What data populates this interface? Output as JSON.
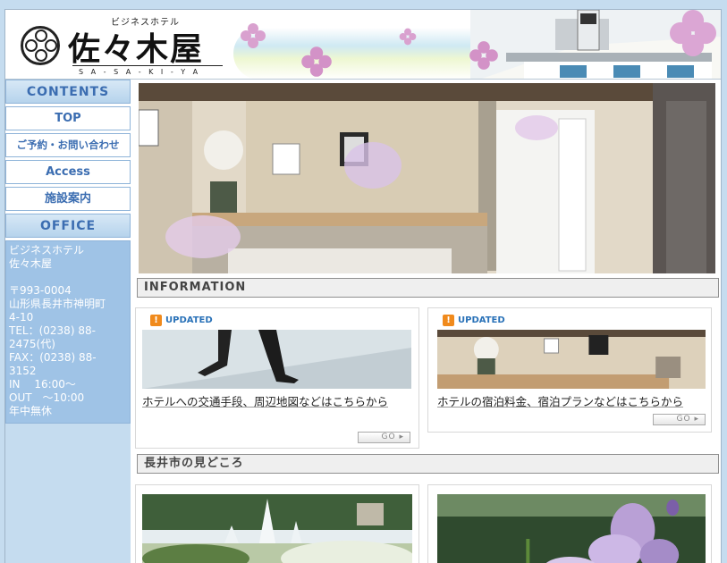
{
  "header": {
    "subtitle": "ビジネスホテル",
    "title": "佐々木屋",
    "roman": "S A - S A - K I - Y A"
  },
  "sidebar": {
    "contents_heading": "CONTENTS",
    "items": [
      {
        "label": "TOP"
      },
      {
        "label": "ご予約・お問い合わせ"
      },
      {
        "label": "Access"
      },
      {
        "label": "施設案内"
      }
    ],
    "office_heading": "OFFICE",
    "office_lines": [
      "ビジネスホテル",
      "佐々木屋",
      "",
      "〒993-0004",
      "山形県長井市神明町",
      "4-10",
      "TEL：(0238) 88-",
      "2475(代)",
      "FAX：(0238) 88-",
      "3152",
      "IN　 16:00～",
      "OUT　～10:00",
      "年中無休"
    ]
  },
  "main": {
    "information_heading": "INFORMATION",
    "cards": [
      {
        "badge": "UPDATED",
        "text": "ホテルへの交通手段、周辺地図などはこちらから",
        "go": "GO"
      },
      {
        "badge": "UPDATED",
        "text": "ホテルの宿泊料金、宿泊プランなどはこちらから",
        "go": "GO"
      }
    ],
    "sights_heading": "長井市の見どころ"
  },
  "colors": {
    "accent": "#3b6db1",
    "sidebar_bg": "#9fc3e6",
    "badge": "#f08a1c"
  }
}
